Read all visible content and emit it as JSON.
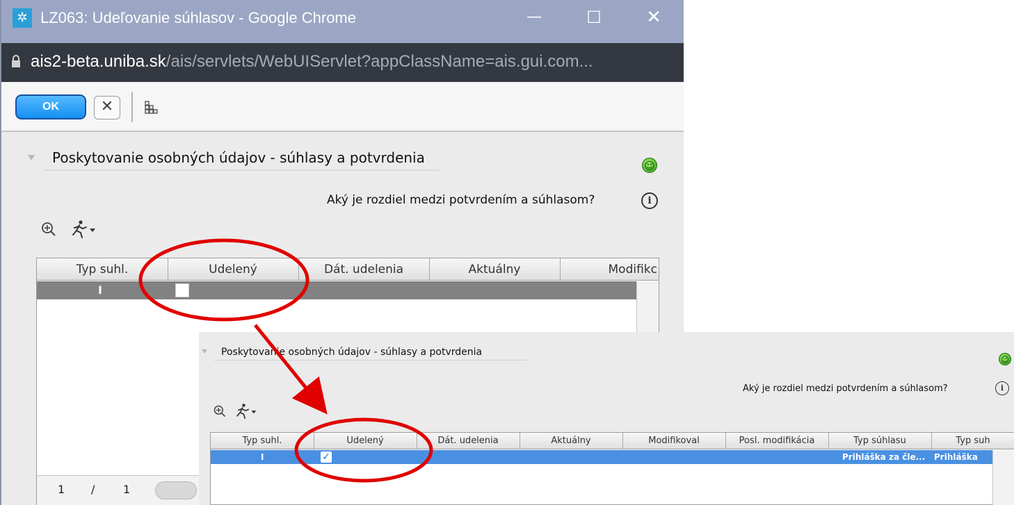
{
  "window": {
    "title": "LZ063: Udeľovanie súhlasov - Google Chrome",
    "url_host": "ais2-beta.uniba.sk",
    "url_path": "/ais/servlets/WebUIServlet?appClassName=ais.gui.com...",
    "icons": [
      "app-icon",
      "minimize-icon",
      "maximize-icon",
      "close-icon",
      "lock-icon"
    ]
  },
  "toolbar": {
    "ok_label": "OK",
    "cancel_glyph": "✕",
    "icons": [
      "grid-icon"
    ]
  },
  "panel": {
    "title": "Poskytovanie osobných údajov - súhlasy a potvrdenia",
    "question": "Aký je rozdiel medzi potvrdením a súhlasom?",
    "icons": [
      "smiley-icon",
      "info-icon",
      "zoom-icon",
      "run-icon"
    ]
  },
  "table_back": {
    "columns": [
      "Typ suhl.",
      "Udelený",
      "Dát. udelenia",
      "Aktuálny",
      "Modifikc"
    ],
    "row": {
      "typ": "I",
      "udeleny": false
    },
    "pager": {
      "current": "1",
      "sep": "/",
      "total": "1"
    }
  },
  "table_front": {
    "columns": [
      "Typ suhl.",
      "Udelený",
      "Dát. udelenia",
      "Aktuálny",
      "Modifikoval",
      "Posl. modifikácia",
      "Typ súhlasu",
      "Typ suh"
    ],
    "row": {
      "typ": "I",
      "udeleny": true,
      "typ_suhlasu": "Prihláška za čle...",
      "typ_suh": "Prihláška"
    }
  },
  "colors": {
    "annotation": "#e00000",
    "selected_row_back": "#828282",
    "selected_row_front": "#4a90e2",
    "titlebar": "#9aa6c4",
    "addressbar": "#343840",
    "ok_button": "#2a9df4"
  }
}
